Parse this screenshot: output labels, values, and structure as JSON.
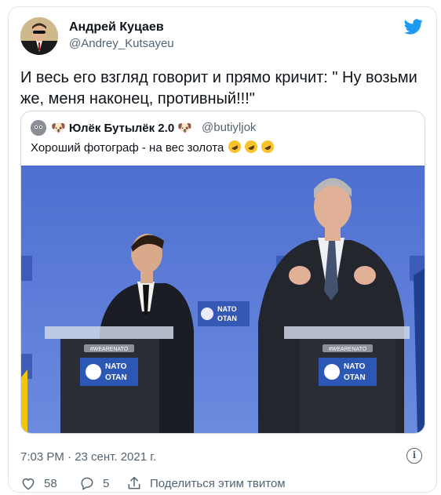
{
  "tweet": {
    "author_name": "Андрей Куцаев",
    "author_handle": "@Andrey_Kutsayeu",
    "text": "И весь его взгляд говорит и прямо кричит: \" Ну возьми же, меня наконец, противный!!!\"",
    "timestamp": "7:03 PM · 23 сент. 2021 г.",
    "likes": "58",
    "replies": "5",
    "share_label": "Поделиться этим твитом"
  },
  "quote": {
    "author_name": "Юлёк Бутылёк 2.0",
    "author_handle": "@butiyljok",
    "text": "Хороший фотограф - на вес золота",
    "emoji_icons": [
      "rofl-emoji",
      "rofl-emoji",
      "rofl-emoji"
    ]
  },
  "photo": {
    "backdrop_label": "NATO OTAN",
    "podium_tag": "#WEARENATO",
    "podium_label_top": "NATO",
    "podium_label_bottom": "OTAN"
  },
  "colors": {
    "twitter_blue": "#1d9bf0",
    "text_primary": "#0f1419",
    "text_secondary": "#536471",
    "nato_blue": "#2d57b4",
    "backdrop_blue": "#5b7ad8"
  }
}
